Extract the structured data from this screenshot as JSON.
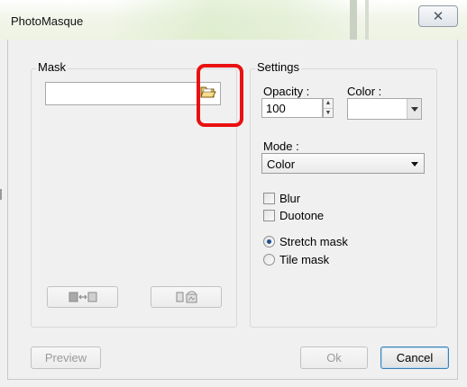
{
  "window": {
    "title": "PhotoMasque",
    "close_glyph": "✕"
  },
  "mask": {
    "group_label": "Mask",
    "file_path": "",
    "browse_icon": "folder-open-icon",
    "flip_icon": "swap-image-icon",
    "rotate_icon": "rotate-image-icon"
  },
  "settings": {
    "group_label": "Settings",
    "opacity_label": "Opacity :",
    "opacity_value": "100",
    "color_label": "Color :",
    "color_value": "#ffffff",
    "mode_label": "Mode :",
    "mode_value": "Color",
    "blur_label": "Blur",
    "blur_checked": false,
    "duotone_label": "Duotone",
    "duotone_checked": false,
    "stretch_label": "Stretch mask",
    "stretch_selected": true,
    "tile_label": "Tile mask",
    "tile_selected": false
  },
  "footer": {
    "preview_label": "Preview",
    "ok_label": "Ok",
    "cancel_label": "Cancel"
  },
  "colors": {
    "highlight_border": "#e81010",
    "dialog_background": "#f0f0f0"
  }
}
